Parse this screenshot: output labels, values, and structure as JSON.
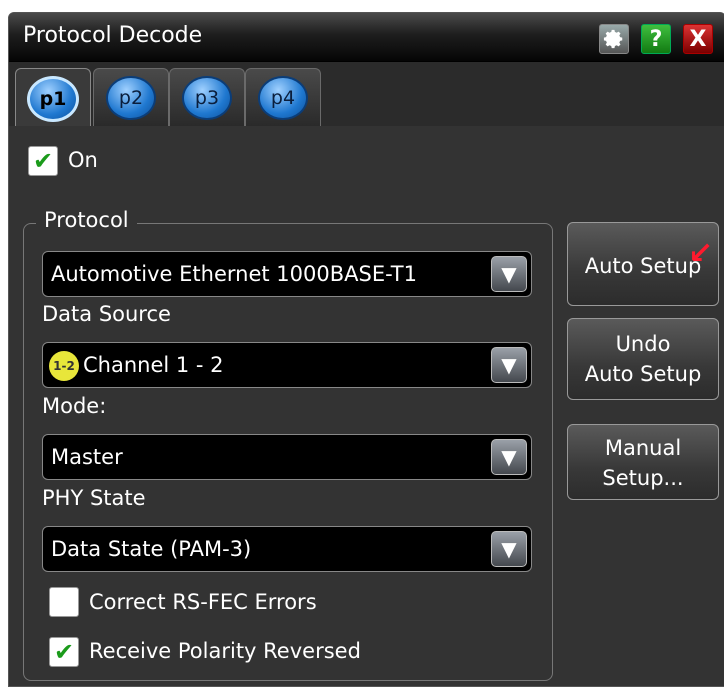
{
  "window": {
    "title": "Protocol Decode"
  },
  "titlebar_buttons": {
    "help": "?",
    "close": "X",
    "gear_icon": "gear-icon"
  },
  "tabs": [
    {
      "label": "p1",
      "active": true
    },
    {
      "label": "p2",
      "active": false
    },
    {
      "label": "p3",
      "active": false
    },
    {
      "label": "p4",
      "active": false
    }
  ],
  "on": {
    "label": "On",
    "checked": true
  },
  "protocol_group": {
    "legend": "Protocol",
    "protocol_value": "Automotive Ethernet 1000BASE-T1",
    "data_source_label": "Data Source",
    "data_source_badge": "1-2",
    "data_source_value": "Channel 1 - 2",
    "mode_label": "Mode:",
    "mode_value": "Master",
    "phy_state_label": "PHY State",
    "phy_state_value": "Data State (PAM-3)",
    "rsfec": {
      "label": "Correct RS-FEC Errors",
      "checked": false
    },
    "polarity": {
      "label": "Receive Polarity Reversed",
      "checked": true
    }
  },
  "side_buttons": {
    "auto_setup": "Auto Setup",
    "undo_auto_setup_line1": "Undo",
    "undo_auto_setup_line2": "Auto Setup",
    "manual_setup_line1": "Manual",
    "manual_setup_line2": "Setup..."
  },
  "colors": {
    "accent_arrow": "#ff1a2e",
    "check": "#1b9b1b",
    "tab_pill": "#1f78d0",
    "source_badge": "#e8e63a"
  }
}
